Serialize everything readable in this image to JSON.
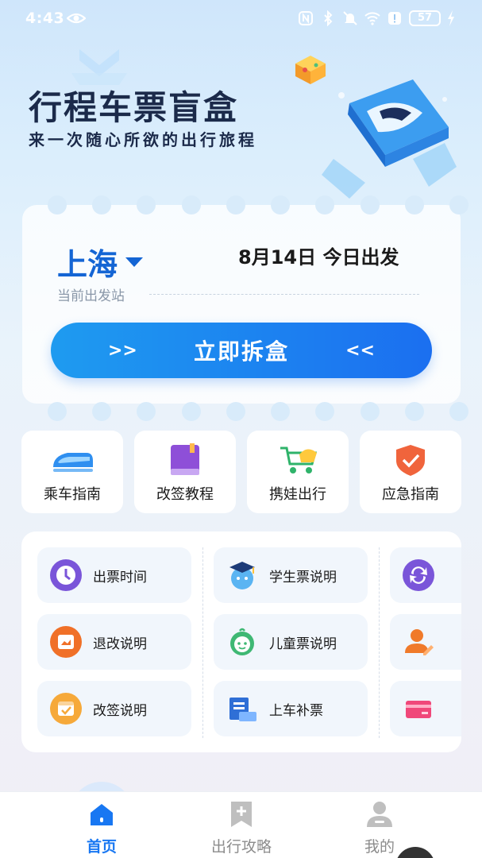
{
  "status_bar": {
    "time": "4:43",
    "battery": "57"
  },
  "hero": {
    "title": "行程车票盲盒",
    "subtitle": "来一次随心所欲的出行旅程"
  },
  "ticket": {
    "city": "上海",
    "date": "8月14日 今日出发",
    "station_hint": "当前出发站",
    "open_button": {
      "left_arrow": ">>",
      "label": "立即拆盒",
      "right_arrow": "<<"
    }
  },
  "guides": [
    {
      "label": "乘车指南",
      "icon": "train-icon"
    },
    {
      "label": "改签教程",
      "icon": "book-icon"
    },
    {
      "label": "携娃出行",
      "icon": "stroller-icon"
    },
    {
      "label": "应急指南",
      "icon": "shield-check-icon"
    }
  ],
  "info_items": [
    {
      "label": "出票时间",
      "icon": "clock-icon"
    },
    {
      "label": "学生票说明",
      "icon": "student-icon"
    },
    {
      "label": "",
      "icon": "refresh-icon"
    },
    {
      "label": "退改说明",
      "icon": "refund-icon"
    },
    {
      "label": "儿童票说明",
      "icon": "child-icon"
    },
    {
      "label": "",
      "icon": "user-edit-icon"
    },
    {
      "label": "改签说明",
      "icon": "calendar-check-icon"
    },
    {
      "label": "上车补票",
      "icon": "ticket-receipt-icon"
    },
    {
      "label": "",
      "icon": "card-icon"
    }
  ],
  "nav": [
    {
      "label": "首页",
      "icon": "home-icon",
      "active": true
    },
    {
      "label": "出行攻略",
      "icon": "bookmark-plus-icon",
      "active": false
    },
    {
      "label": "我的",
      "icon": "user-icon",
      "active": false
    }
  ],
  "colors": {
    "accent": "#1877f2",
    "button_start": "#1e9bf0",
    "button_end": "#1b6ff0",
    "city": "#1465d4"
  }
}
